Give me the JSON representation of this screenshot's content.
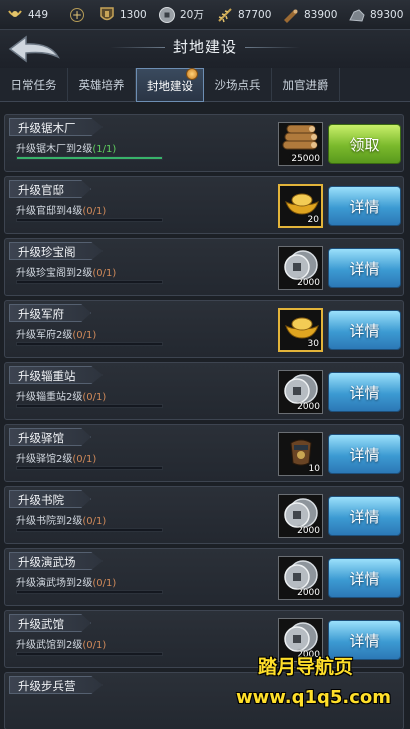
{
  "resources": [
    {
      "icon": "laurel-icon",
      "value": "449"
    },
    {
      "icon": "plus-icon",
      "value": ""
    },
    {
      "icon": "shield-icon",
      "value": "1300"
    },
    {
      "icon": "coin-icon",
      "value": "20万"
    },
    {
      "icon": "grain-icon",
      "value": "87700"
    },
    {
      "icon": "lumber-icon",
      "value": "83900"
    },
    {
      "icon": "stone-icon",
      "value": "89300"
    }
  ],
  "header": {
    "title": "封地建设",
    "back_icon": "back-arrow-icon"
  },
  "tabs": [
    {
      "label": "日常任务",
      "active": false
    },
    {
      "label": "英雄培养",
      "active": false
    },
    {
      "label": "封地建设",
      "active": true,
      "badge": true
    },
    {
      "label": "沙场点兵",
      "active": false
    },
    {
      "label": "加官进爵",
      "active": false
    }
  ],
  "tasks": [
    {
      "title": "升级锯木厂",
      "desc": "升级锯木厂到2级",
      "progress": "(1/1)",
      "done": true,
      "progress_fraction": 1,
      "reward_icon": "lumber-icon",
      "reward_qty": "25000",
      "button": "领取",
      "button_type": "claim",
      "gold": false
    },
    {
      "title": "升级官邸",
      "desc": "升级官邸到4级",
      "progress": "(0/1)",
      "done": false,
      "progress_fraction": 0,
      "reward_icon": "gold-ingot-icon",
      "reward_qty": "20",
      "button": "详情",
      "button_type": "detail",
      "gold": true
    },
    {
      "title": "升级珍宝阁",
      "desc": "升级珍宝阁到2级",
      "progress": "(0/1)",
      "done": false,
      "progress_fraction": 0,
      "reward_icon": "silver-coin-icon",
      "reward_qty": "2000",
      "button": "详情",
      "button_type": "detail",
      "gold": false
    },
    {
      "title": "升级军府",
      "desc": "升级军府2级",
      "progress": "(0/1)",
      "done": false,
      "progress_fraction": 0,
      "reward_icon": "gold-ingot-icon",
      "reward_qty": "30",
      "button": "详情",
      "button_type": "detail",
      "gold": true
    },
    {
      "title": "升级辎重站",
      "desc": "升级辎重站2级",
      "progress": "(0/1)",
      "done": false,
      "progress_fraction": 0,
      "reward_icon": "silver-coin-icon",
      "reward_qty": "2000",
      "button": "详情",
      "button_type": "detail",
      "gold": false
    },
    {
      "title": "升级驿馆",
      "desc": "升级驿馆2级",
      "progress": "(0/1)",
      "done": false,
      "progress_fraction": 0,
      "reward_icon": "scroll-bag-icon",
      "reward_qty": "10",
      "button": "详情",
      "button_type": "detail",
      "gold": false
    },
    {
      "title": "升级书院",
      "desc": "升级书院到2级",
      "progress": "(0/1)",
      "done": false,
      "progress_fraction": 0,
      "reward_icon": "silver-coin-icon",
      "reward_qty": "2000",
      "button": "详情",
      "button_type": "detail",
      "gold": false
    },
    {
      "title": "升级演武场",
      "desc": "升级演武场到2级",
      "progress": "(0/1)",
      "done": false,
      "progress_fraction": 0,
      "reward_icon": "silver-coin-icon",
      "reward_qty": "2000",
      "button": "详情",
      "button_type": "detail",
      "gold": false
    },
    {
      "title": "升级武馆",
      "desc": "升级武馆到2级",
      "progress": "(0/1)",
      "done": false,
      "progress_fraction": 0,
      "reward_icon": "silver-coin-icon",
      "reward_qty": "2000",
      "button": "详情",
      "button_type": "detail",
      "gold": false
    },
    {
      "title": "升级步兵营",
      "desc": "",
      "progress": "",
      "done": false,
      "progress_fraction": 0,
      "reward_icon": "",
      "reward_qty": "",
      "button": "",
      "button_type": "detail",
      "gold": false
    }
  ],
  "watermark": {
    "line1": "踏月导航页",
    "line2": "www.q1q5.com"
  }
}
